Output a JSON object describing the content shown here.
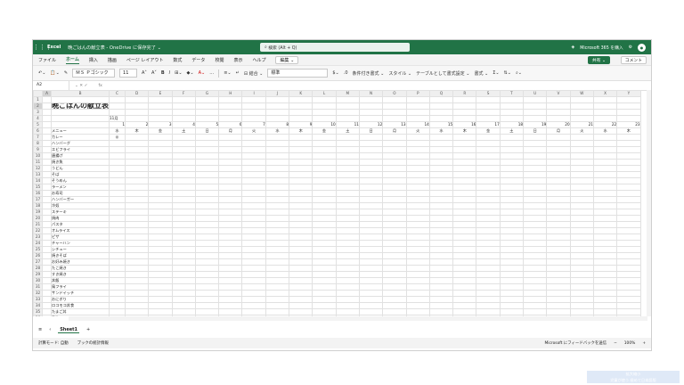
{
  "titlebar": {
    "app": "Excel",
    "doc": "晩ごはんの献立表 - OneDrive に保存完了 ⌄",
    "search_placeholder": "検索 (Alt + Q)",
    "premium": "Microsoft 365 を購入",
    "avatar": "👤"
  },
  "menubar": {
    "tabs": [
      "ファイル",
      "ホーム",
      "挿入",
      "描画",
      "ページ レイアウト",
      "数式",
      "データ",
      "校閲",
      "表示",
      "ヘルプ"
    ],
    "active": 1,
    "edit": "編集 ⌄",
    "share": "共有 ⌄",
    "comment": "コメント"
  },
  "ribbon": {
    "font": "ＭＳ Ｐゴシック",
    "size": "11",
    "format": "標準",
    "cond": "条件付き書式 ⌄",
    "styles": "スタイル ⌄",
    "table": "テーブルとして書式設定 ⌄",
    "cellfmt": "書式 ⌄"
  },
  "formulabar": {
    "namebox": "A2",
    "fx": "fx"
  },
  "sheet": {
    "columns": [
      "A",
      "B",
      "C",
      "D",
      "E",
      "F",
      "G",
      "H",
      "I",
      "J",
      "K",
      "L",
      "M",
      "N",
      "O",
      "P",
      "Q",
      "R",
      "S",
      "T",
      "U",
      "V",
      "W",
      "X",
      "Y"
    ],
    "title": "晩ごはんの献立表",
    "month": "11月",
    "days": [
      "1",
      "2",
      "3",
      "4",
      "5",
      "6",
      "7",
      "8",
      "9",
      "10",
      "11",
      "12",
      "13",
      "14",
      "15",
      "16",
      "17",
      "18",
      "19",
      "20",
      "21",
      "22",
      "23",
      "24"
    ],
    "weekdays": [
      "水",
      "木",
      "金",
      "土",
      "日",
      "月",
      "火",
      "水",
      "木",
      "金",
      "土",
      "日",
      "月",
      "火",
      "水",
      "木",
      "金",
      "土",
      "日",
      "月",
      "火",
      "水",
      "木",
      "金"
    ],
    "header_left": "メニュー",
    "header_mid": "曜",
    "menus": [
      "カレー",
      "ハンバーグ",
      "エビフライ",
      "唐揚げ",
      "焼き魚",
      "うどん",
      "そば",
      "そうめん",
      "ラーメン",
      "お寿司",
      "ハンバーガー",
      "冷奴",
      "ステーキ",
      "焼肉",
      "パスタ",
      "オムライス",
      "ピザ",
      "チャーハン",
      "シチュー",
      "焼きそば",
      "お好み焼き",
      "たこ焼き",
      "すき焼き",
      "丼飯",
      "鳥フライ",
      "サンドイッチ",
      "おにぎり",
      "ロコモコ丼食",
      "たまご丼",
      "煮物",
      "刺身"
    ],
    "first_menu_mark": "◎"
  },
  "sheetbar": {
    "tab": "Sheet1",
    "add": "+"
  },
  "statusbar": {
    "left": "計算モード: 自動",
    "mid": "ブックの統計情報",
    "feedback": "Microsoft にフィードバックを送信",
    "zoom": "100%"
  },
  "cornermark": {
    "line1": "拡大縮小",
    "line2": "児童が使う 極めて日本語版"
  }
}
